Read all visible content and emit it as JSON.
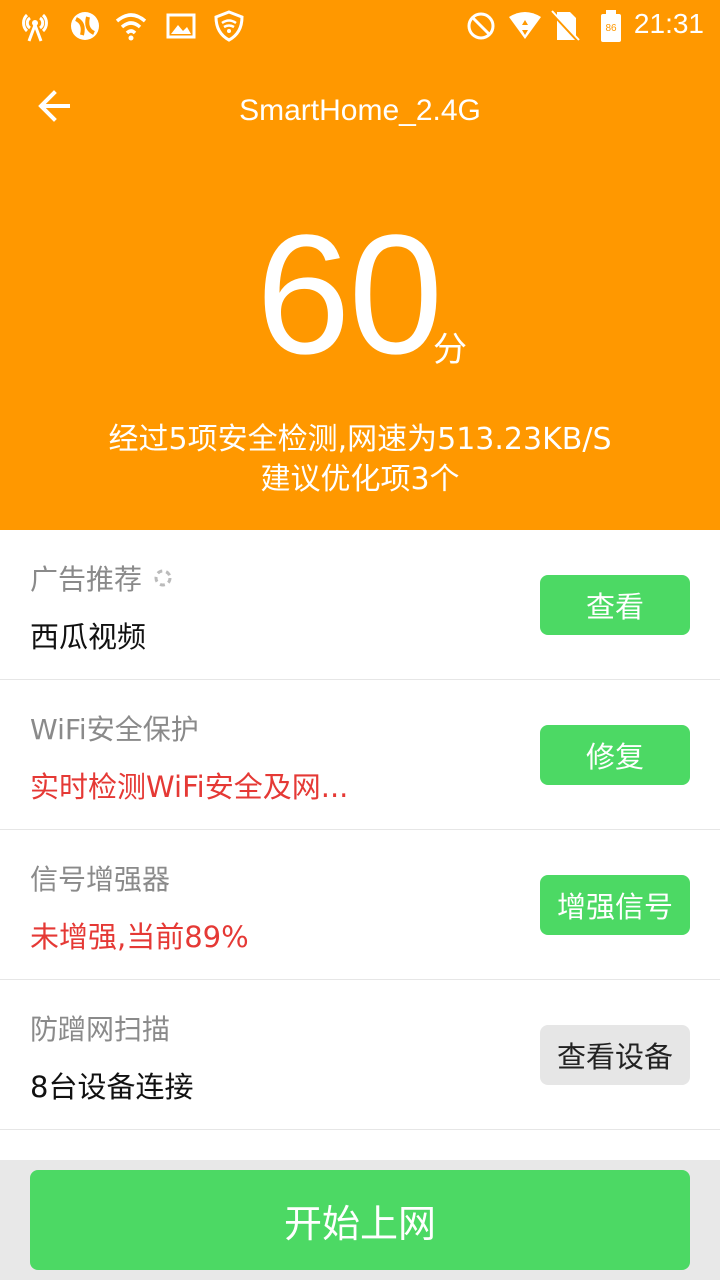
{
  "status_bar": {
    "time": "21:31",
    "battery_level": "86",
    "icons": [
      "signal-tower-icon",
      "network-swirl-icon",
      "wifi-icon",
      "image-icon",
      "shield-icon",
      "do-not-disturb-icon",
      "wifi-data-icon",
      "no-sim-icon",
      "battery-icon"
    ]
  },
  "header": {
    "back_icon": "arrow-left-icon",
    "title": "SmartHome_2.4G",
    "score": "60",
    "score_unit": "分",
    "summary_line1": "经过5项安全检测,网速为513.23KB/S",
    "summary_line2": "建议优化项3个"
  },
  "items": [
    {
      "title": "广告推荐",
      "subtitle": "西瓜视频",
      "button": "查看"
    },
    {
      "title": "WiFi安全保护",
      "subtitle": "实时检测WiFi安全及网...",
      "button": "修复"
    },
    {
      "title": "信号增强器",
      "subtitle": "未增强,当前89%",
      "button": "增强信号"
    },
    {
      "title": "防蹭网扫描",
      "subtitle": "8台设备连接",
      "button": "查看设备"
    }
  ],
  "bottom": {
    "start_label": "开始上网"
  },
  "colors": {
    "header_bg": "#ff9800",
    "green": "#4cd964",
    "red": "#e53935"
  }
}
